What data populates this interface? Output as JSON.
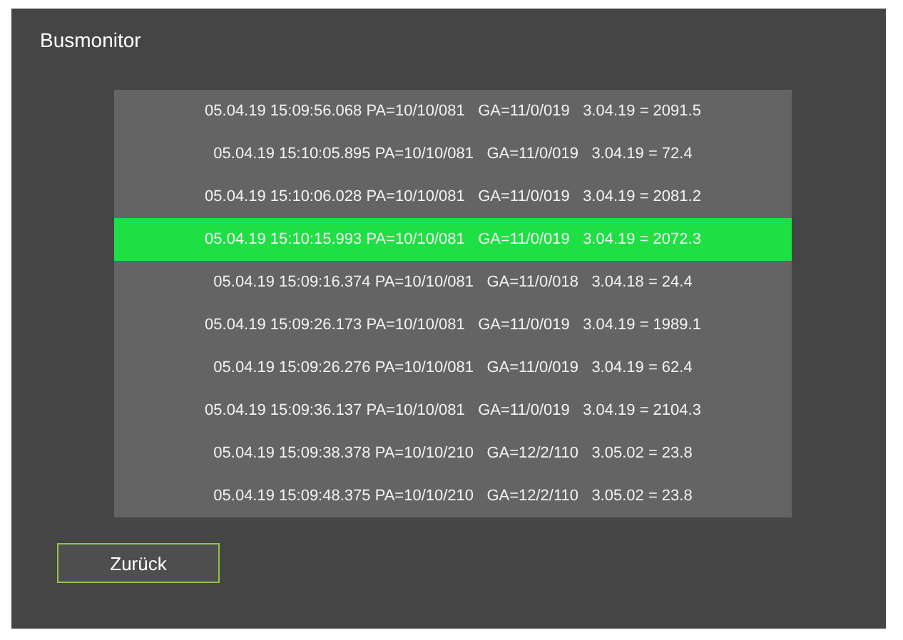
{
  "window": {
    "title": "Busmonitor"
  },
  "messages": [
    {
      "text": "05.04.19 15:09:56.068 PA=10/10/081   GA=11/0/019   3.04.19 = 2091.5",
      "selected": false
    },
    {
      "text": "05.04.19 15:10:05.895 PA=10/10/081   GA=11/0/019   3.04.19 = 72.4",
      "selected": false
    },
    {
      "text": "05.04.19 15:10:06.028 PA=10/10/081   GA=11/0/019   3.04.19 = 2081.2",
      "selected": false
    },
    {
      "text": "05.04.19 15:10:15.993 PA=10/10/081   GA=11/0/019   3.04.19 = 2072.3",
      "selected": true
    },
    {
      "text": "05.04.19 15:09:16.374 PA=10/10/081   GA=11/0/018   3.04.18 = 24.4",
      "selected": false
    },
    {
      "text": "05.04.19 15:09:26.173 PA=10/10/081   GA=11/0/019   3.04.19 = 1989.1",
      "selected": false
    },
    {
      "text": "05.04.19 15:09:26.276 PA=10/10/081   GA=11/0/019   3.04.19 = 62.4",
      "selected": false
    },
    {
      "text": "05.04.19 15:09:36.137 PA=10/10/081   GA=11/0/019   3.04.19 = 2104.3",
      "selected": false
    },
    {
      "text": "05.04.19 15:09:38.378 PA=10/10/210   GA=12/2/110   3.05.02 = 23.8",
      "selected": false
    },
    {
      "text": "05.04.19 15:09:48.375 PA=10/10/210   GA=12/2/110   3.05.02 = 23.8",
      "selected": false
    }
  ],
  "buttons": [
    {
      "label": "Zurück"
    }
  ]
}
